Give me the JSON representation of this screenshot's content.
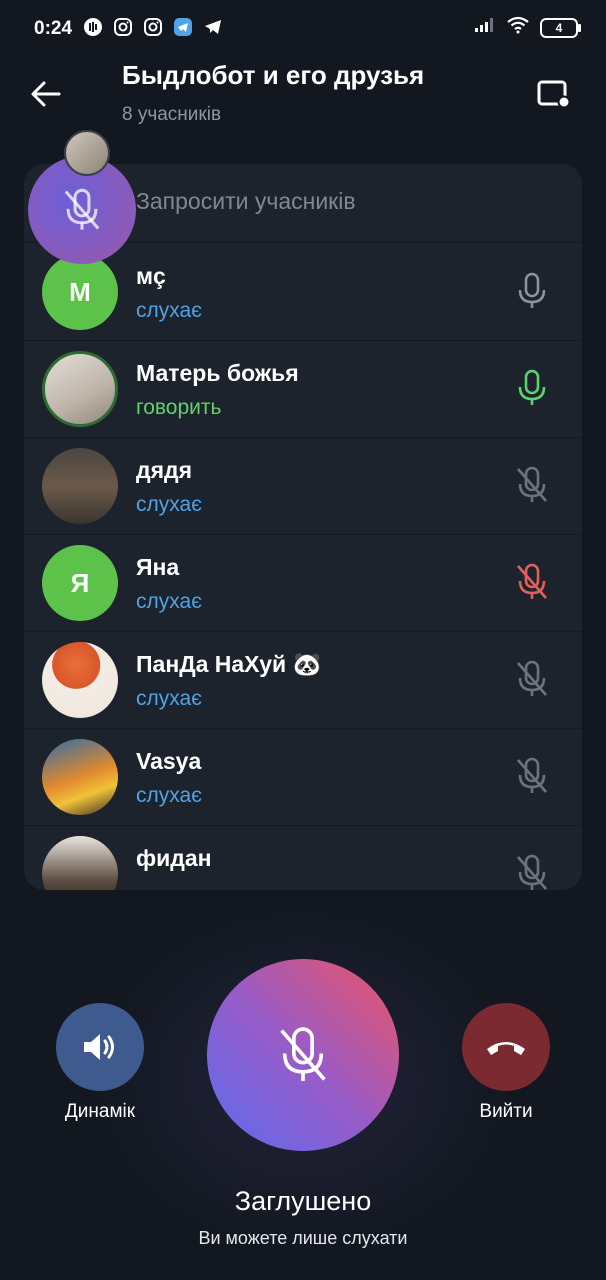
{
  "status_bar": {
    "time": "0:24",
    "battery": "4"
  },
  "header": {
    "title": "Быдлобот и его друзья",
    "subtitle": "8 учасників"
  },
  "invite": {
    "label": "Запросити учасників"
  },
  "participants": [
    {
      "name": "мç",
      "initial": "M",
      "status": "слухає",
      "mic": "mic-icon"
    },
    {
      "name": "Матерь божья",
      "initial": "",
      "status": "говорить",
      "mic": "mic-active-icon"
    },
    {
      "name": "дядя",
      "initial": "",
      "status": "слухає",
      "mic": "mic-muted-icon"
    },
    {
      "name": "Яна",
      "initial": "Я",
      "status": "слухає",
      "mic": "mic-muted-red-icon"
    },
    {
      "name": "ПанДа НаХуй 🐼",
      "initial": "",
      "status": "слухає",
      "mic": "mic-muted-icon"
    },
    {
      "name": "Vasya",
      "initial": "",
      "status": "слухає",
      "mic": "mic-muted-icon"
    },
    {
      "name": "фидан",
      "initial": "",
      "status": "",
      "mic": "mic-muted-icon"
    }
  ],
  "controls": {
    "speaker_label": "Динамік",
    "leave_label": "Вийти"
  },
  "muted": {
    "title": "Заглушено",
    "subtitle": "Ви можете лише слухати"
  },
  "colors": {
    "listening": "#4fa3e6",
    "speaking": "#5ed36b",
    "muted_red": "#e0605e",
    "avatar_green": "#5cc24a"
  }
}
